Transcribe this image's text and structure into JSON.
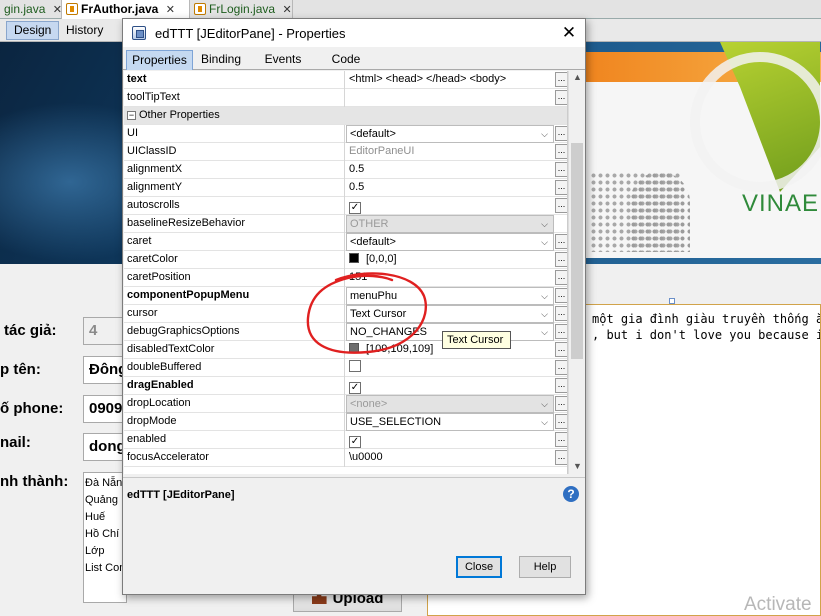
{
  "ide": {
    "tabs": [
      {
        "label": "gin.java"
      },
      {
        "label": "FrAuthor.java"
      },
      {
        "label": "FrLogin.java"
      }
    ],
    "design_label": "Design",
    "history_label": "History"
  },
  "banner": {
    "brand_text": "VINAE"
  },
  "form": {
    "labels": [
      "tác giả:",
      "p tên:",
      "ố phone:",
      "nail:",
      "nh thành:"
    ],
    "values": [
      "4",
      "Đông",
      "0909",
      "dong"
    ],
    "province_items": [
      "Đà Nẵng",
      "Quảng N",
      "Huế",
      "Hồ Chí M",
      "Lớp",
      "List Com"
    ],
    "upload_label": "Upload",
    "editor_lines": [
      "một gia đình giàu truyền thống ăn",
      ", but i don't love you because i h"
    ]
  },
  "dialog": {
    "title": "edTTT [JEditorPane] - Properties",
    "close_glyph": "✕",
    "tabs": [
      "Properties",
      "Binding",
      "Events",
      "Code"
    ],
    "rows": [
      {
        "name": "text",
        "value": "<html>  <head>  </head>  <body>",
        "bold": true,
        "kind": "text",
        "ell": true
      },
      {
        "name": "toolTipText",
        "value": "",
        "bold": false,
        "kind": "text",
        "ell": true
      },
      {
        "name": "Other Properties",
        "value": "",
        "bold": false,
        "kind": "section",
        "ell": false
      },
      {
        "name": "UI",
        "value": "<default>",
        "bold": false,
        "kind": "dropdown",
        "ell": true
      },
      {
        "name": "UIClassID",
        "value": "EditorPaneUI",
        "bold": false,
        "kind": "gray",
        "ell": true
      },
      {
        "name": "alignmentX",
        "value": "0.5",
        "bold": false,
        "kind": "text",
        "ell": true
      },
      {
        "name": "alignmentY",
        "value": "0.5",
        "bold": false,
        "kind": "text",
        "ell": true
      },
      {
        "name": "autoscrolls",
        "value": "",
        "bold": false,
        "kind": "checkbox",
        "checked": true,
        "ell": true
      },
      {
        "name": "baselineResizeBehavior",
        "value": "OTHER",
        "bold": false,
        "kind": "dropdown-disabled",
        "ell": false
      },
      {
        "name": "caret",
        "value": "<default>",
        "bold": false,
        "kind": "dropdown",
        "ell": true
      },
      {
        "name": "caretColor",
        "value": "[0,0,0]",
        "bold": false,
        "kind": "color",
        "color": "#000000",
        "ell": true
      },
      {
        "name": "caretPosition",
        "value": "151",
        "bold": false,
        "kind": "text",
        "ell": true
      },
      {
        "name": "componentPopupMenu",
        "value": "menuPhu",
        "bold": true,
        "kind": "dropdown",
        "ell": true
      },
      {
        "name": "cursor",
        "value": "Text Cursor",
        "bold": false,
        "kind": "dropdown",
        "ell": true
      },
      {
        "name": "debugGraphicsOptions",
        "value": "NO_CHANGES",
        "bold": false,
        "kind": "dropdown",
        "ell": true
      },
      {
        "name": "disabledTextColor",
        "value": "[109,109,109]",
        "bold": false,
        "kind": "color",
        "color": "#6d6d6d",
        "ell": true
      },
      {
        "name": "doubleBuffered",
        "value": "",
        "bold": false,
        "kind": "checkbox",
        "checked": false,
        "ell": true
      },
      {
        "name": "dragEnabled",
        "value": "",
        "bold": true,
        "kind": "checkbox",
        "checked": true,
        "ell": true
      },
      {
        "name": "dropLocation",
        "value": "<none>",
        "bold": false,
        "kind": "dropdown-disabled",
        "ell": true
      },
      {
        "name": "dropMode",
        "value": "USE_SELECTION",
        "bold": false,
        "kind": "dropdown",
        "ell": true
      },
      {
        "name": "enabled",
        "value": "",
        "bold": false,
        "kind": "checkbox",
        "checked": true,
        "ell": true
      },
      {
        "name": "focusAccelerator",
        "value": "\\u0000",
        "bold": false,
        "kind": "text",
        "ell": true
      }
    ],
    "description_title": "edTTT [JEditorPane]",
    "close_label": "Close",
    "help_label": "Help",
    "tooltip": "Text Cursor",
    "ellipsis": "..."
  },
  "watermark": "Activate",
  "colors": {
    "annotation": "#e02020",
    "selected_tab": "#c5d9f1"
  }
}
